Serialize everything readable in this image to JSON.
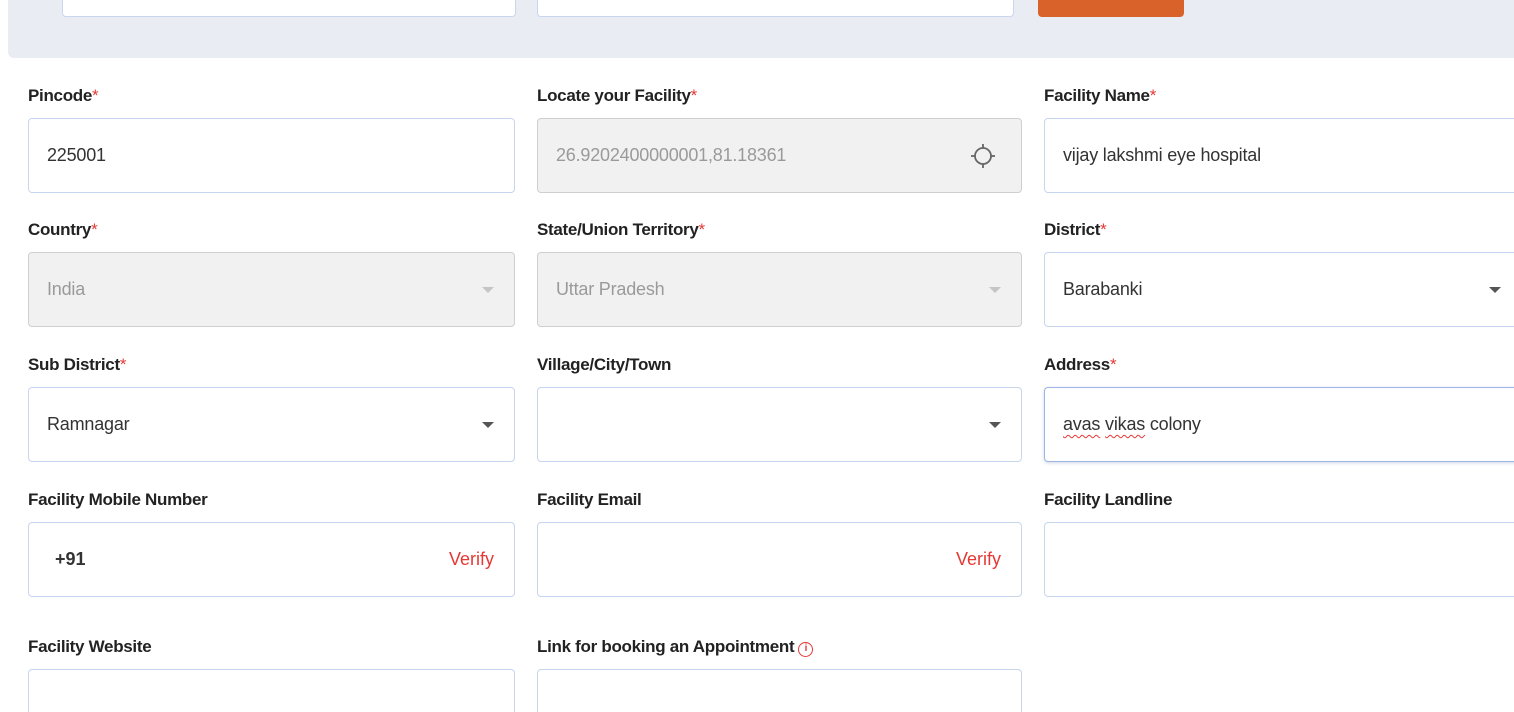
{
  "form": {
    "pincode": {
      "label": "Pincode",
      "value": "225001"
    },
    "locate": {
      "label": "Locate your Facility",
      "value": "26.9202400000001,81.18361"
    },
    "facility_name": {
      "label": "Facility Name",
      "value": "vijay lakshmi eye hospital"
    },
    "country": {
      "label": "Country",
      "value": "India"
    },
    "state": {
      "label": "State/Union Territory",
      "value": "Uttar Pradesh"
    },
    "district": {
      "label": "District",
      "value": "Barabanki"
    },
    "sub_district": {
      "label": "Sub District",
      "value": "Ramnagar"
    },
    "village": {
      "label": "Village/City/Town",
      "value": ""
    },
    "address": {
      "label": "Address",
      "value_words": [
        "avas",
        "vikas",
        "colony"
      ]
    },
    "mobile": {
      "label": "Facility Mobile Number",
      "prefix": "+91",
      "verify": "Verify"
    },
    "email": {
      "label": "Facility Email",
      "verify": "Verify"
    },
    "landline": {
      "label": "Facility Landline",
      "value": ""
    },
    "website": {
      "label": "Facility Website",
      "value": ""
    },
    "booking_link": {
      "label": "Link for booking an Appointment",
      "info_icon": "info-circle-icon"
    },
    "required_marker": "*"
  },
  "colors": {
    "accent_button": "#d9622b",
    "required": "#e53935",
    "field_border": "#c7d5ef",
    "top_band": "#e9ecf2"
  }
}
